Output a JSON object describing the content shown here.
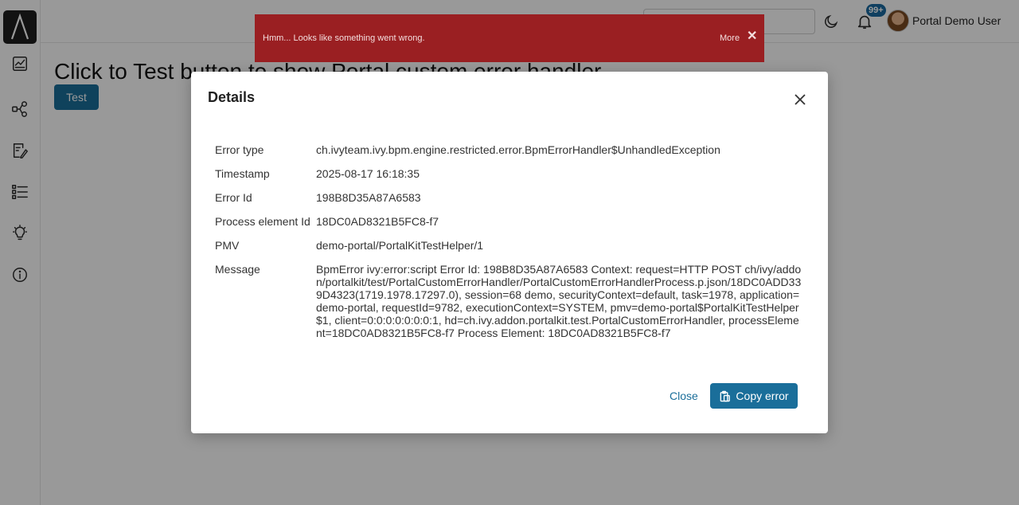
{
  "header": {
    "search_placeholder": "",
    "notification_count": "99+",
    "user_name": "Portal Demo User"
  },
  "sidebar": {
    "icons": [
      "dashboard-icon",
      "process-icon",
      "task-icon",
      "list-icon",
      "idea-icon",
      "info-icon"
    ]
  },
  "page": {
    "title": "Click to Test button to show Portal custom error handler",
    "test_label": "Test"
  },
  "growl": {
    "message": "Hmm... Looks like something went wrong.",
    "more_label": "More",
    "close_glyph": "✕"
  },
  "dialog": {
    "title": "Details",
    "rows": [
      {
        "label": "Error type",
        "value": "ch.ivyteam.ivy.bpm.engine.restricted.error.BpmErrorHandler$UnhandledException"
      },
      {
        "label": "Timestamp",
        "value": "2025-08-17 16:18:35"
      },
      {
        "label": "Error Id",
        "value": "198B8D35A87A6583"
      },
      {
        "label": "Process element Id",
        "value": "18DC0AD8321B5FC8-f7"
      },
      {
        "label": "PMV",
        "value": "demo-portal/PortalKitTestHelper/1"
      },
      {
        "label": "Message",
        "value": "BpmError ivy:error:script Error Id: 198B8D35A87A6583 Context: request=HTTP POST ch/ivy/addon/portalkit/test/PortalCustomErrorHandler/PortalCustomErrorHandlerProcess.p.json/18DC0ADD339D4323(1719.1978.17297.0), session=68 demo, securityContext=default, task=1978, application=demo-portal, requestId=9782, executionContext=SYSTEM, pmv=demo-portal$PortalKitTestHelper$1, client=0:0:0:0:0:0:0:1, hd=ch.ivy.addon.portalkit.test.PortalCustomErrorHandler, processElement=18DC0AD8321B5FC8-f7 Process Element: 18DC0AD8321B5FC8-f7"
      }
    ],
    "close_label": "Close",
    "copy_label": "Copy error"
  },
  "colors": {
    "primary": "#1a6e9a",
    "growl_error": "#9a1f22",
    "badge": "#1a6aa0"
  }
}
